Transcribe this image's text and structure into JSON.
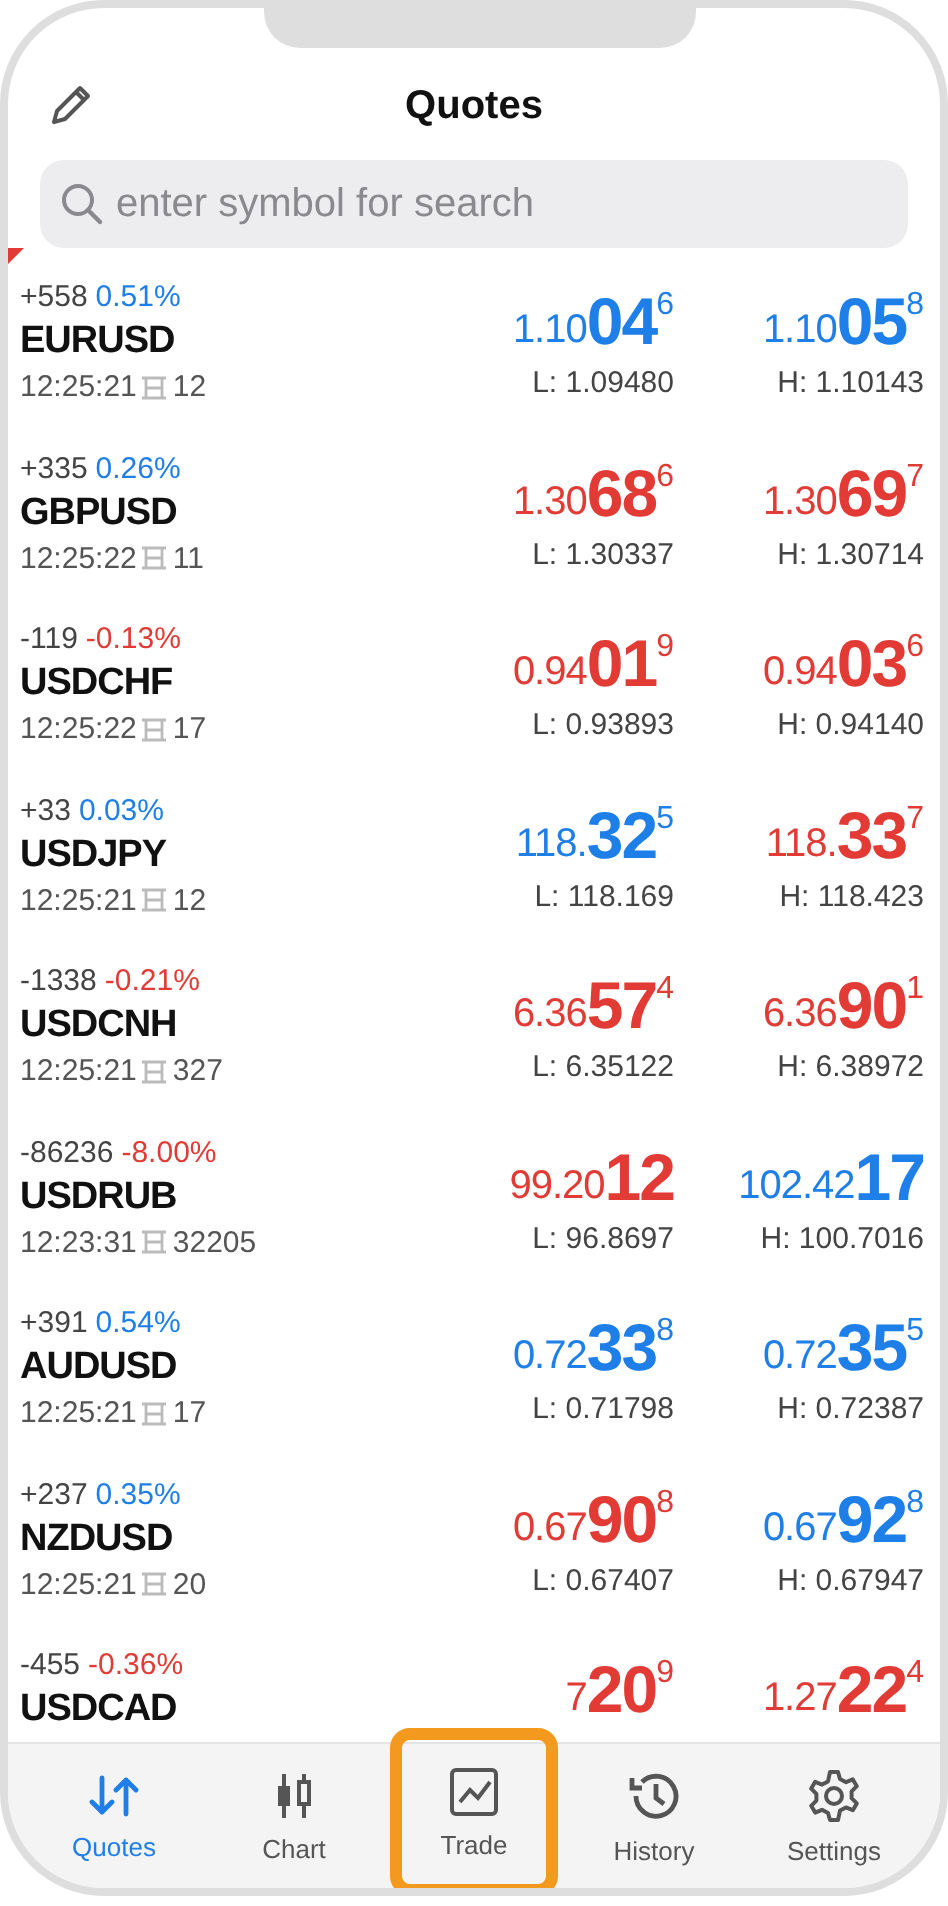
{
  "header": {
    "title": "Quotes"
  },
  "search": {
    "placeholder": "enter symbol for search"
  },
  "quotes": [
    {
      "change": "+558",
      "percent": {
        "text": "0.51%",
        "color": "#1f7fe8"
      },
      "symbol": "EURUSD",
      "time": "12:25:21",
      "spread": "12",
      "bid": {
        "prefix": "1.10",
        "big": "04",
        "sup": "6",
        "color": "#1f7fe8"
      },
      "ask": {
        "prefix": "1.10",
        "big": "05",
        "sup": "8",
        "color": "#1f7fe8"
      },
      "low": "L: 1.09480",
      "high": "H: 1.10143"
    },
    {
      "change": "+335",
      "percent": {
        "text": "0.26%",
        "color": "#1f7fe8"
      },
      "symbol": "GBPUSD",
      "time": "12:25:22",
      "spread": "11",
      "bid": {
        "prefix": "1.30",
        "big": "68",
        "sup": "6",
        "color": "#e23b35"
      },
      "ask": {
        "prefix": "1.30",
        "big": "69",
        "sup": "7",
        "color": "#e23b35"
      },
      "low": "L: 1.30337",
      "high": "H: 1.30714"
    },
    {
      "change": "-119",
      "percent": {
        "text": "-0.13%",
        "color": "#e23b35"
      },
      "symbol": "USDCHF",
      "time": "12:25:22",
      "spread": "17",
      "bid": {
        "prefix": "0.94",
        "big": "01",
        "sup": "9",
        "color": "#e23b35"
      },
      "ask": {
        "prefix": "0.94",
        "big": "03",
        "sup": "6",
        "color": "#e23b35"
      },
      "low": "L: 0.93893",
      "high": "H: 0.94140"
    },
    {
      "change": "+33",
      "percent": {
        "text": "0.03%",
        "color": "#1f7fe8"
      },
      "symbol": "USDJPY",
      "time": "12:25:21",
      "spread": "12",
      "bid": {
        "prefix": "118.",
        "big": "32",
        "sup": "5",
        "color": "#1f7fe8"
      },
      "ask": {
        "prefix": "118.",
        "big": "33",
        "sup": "7",
        "color": "#e23b35"
      },
      "low": "L: 118.169",
      "high": "H: 118.423"
    },
    {
      "change": "-1338",
      "percent": {
        "text": "-0.21%",
        "color": "#e23b35"
      },
      "symbol": "USDCNH",
      "time": "12:25:21",
      "spread": "327",
      "bid": {
        "prefix": "6.36",
        "big": "57",
        "sup": "4",
        "color": "#e23b35"
      },
      "ask": {
        "prefix": "6.36",
        "big": "90",
        "sup": "1",
        "color": "#e23b35"
      },
      "low": "L: 6.35122",
      "high": "H: 6.38972"
    },
    {
      "change": "-86236",
      "percent": {
        "text": "-8.00%",
        "color": "#e23b35"
      },
      "symbol": "USDRUB",
      "time": "12:23:31",
      "spread": "32205",
      "bid": {
        "prefix": "99.20",
        "big": "12",
        "color": "#e23b35"
      },
      "ask": {
        "prefix": "102.42",
        "big": "17",
        "color": "#1f7fe8"
      },
      "low": "L: 96.8697",
      "high": "H: 100.7016"
    },
    {
      "change": "+391",
      "percent": {
        "text": "0.54%",
        "color": "#1f7fe8"
      },
      "symbol": "AUDUSD",
      "time": "12:25:21",
      "spread": "17",
      "bid": {
        "prefix": "0.72",
        "big": "33",
        "sup": "8",
        "color": "#1f7fe8"
      },
      "ask": {
        "prefix": "0.72",
        "big": "35",
        "sup": "5",
        "color": "#1f7fe8"
      },
      "low": "L: 0.71798",
      "high": "H: 0.72387"
    },
    {
      "change": "+237",
      "percent": {
        "text": "0.35%",
        "color": "#1f7fe8"
      },
      "symbol": "NZDUSD",
      "time": "12:25:21",
      "spread": "20",
      "bid": {
        "prefix": "0.67",
        "big": "90",
        "sup": "8",
        "color": "#e23b35"
      },
      "ask": {
        "prefix": "0.67",
        "big": "92",
        "sup": "8",
        "color": "#1f7fe8"
      },
      "low": "L: 0.67407",
      "high": "H: 0.67947"
    },
    {
      "change": "-455",
      "percent": {
        "text": "-0.36%",
        "color": "#e23b35"
      },
      "symbol": "USDCAD",
      "bid": {
        "prefix": "7",
        "big": "20",
        "sup": "9",
        "color": "#e23b35"
      },
      "ask": {
        "prefix": "1.27",
        "big": "22",
        "sup": "4",
        "color": "#e23b35"
      }
    }
  ],
  "tabs": [
    {
      "label": "Quotes",
      "kind": "quotes",
      "selected": true,
      "highlighted": false
    },
    {
      "label": "Chart",
      "kind": "chart",
      "selected": false,
      "highlighted": false
    },
    {
      "label": "Trade",
      "kind": "trade",
      "selected": false,
      "highlighted": true
    },
    {
      "label": "History",
      "kind": "history",
      "selected": false,
      "highlighted": false
    },
    {
      "label": "Settings",
      "kind": "settings",
      "selected": false,
      "highlighted": false
    }
  ]
}
